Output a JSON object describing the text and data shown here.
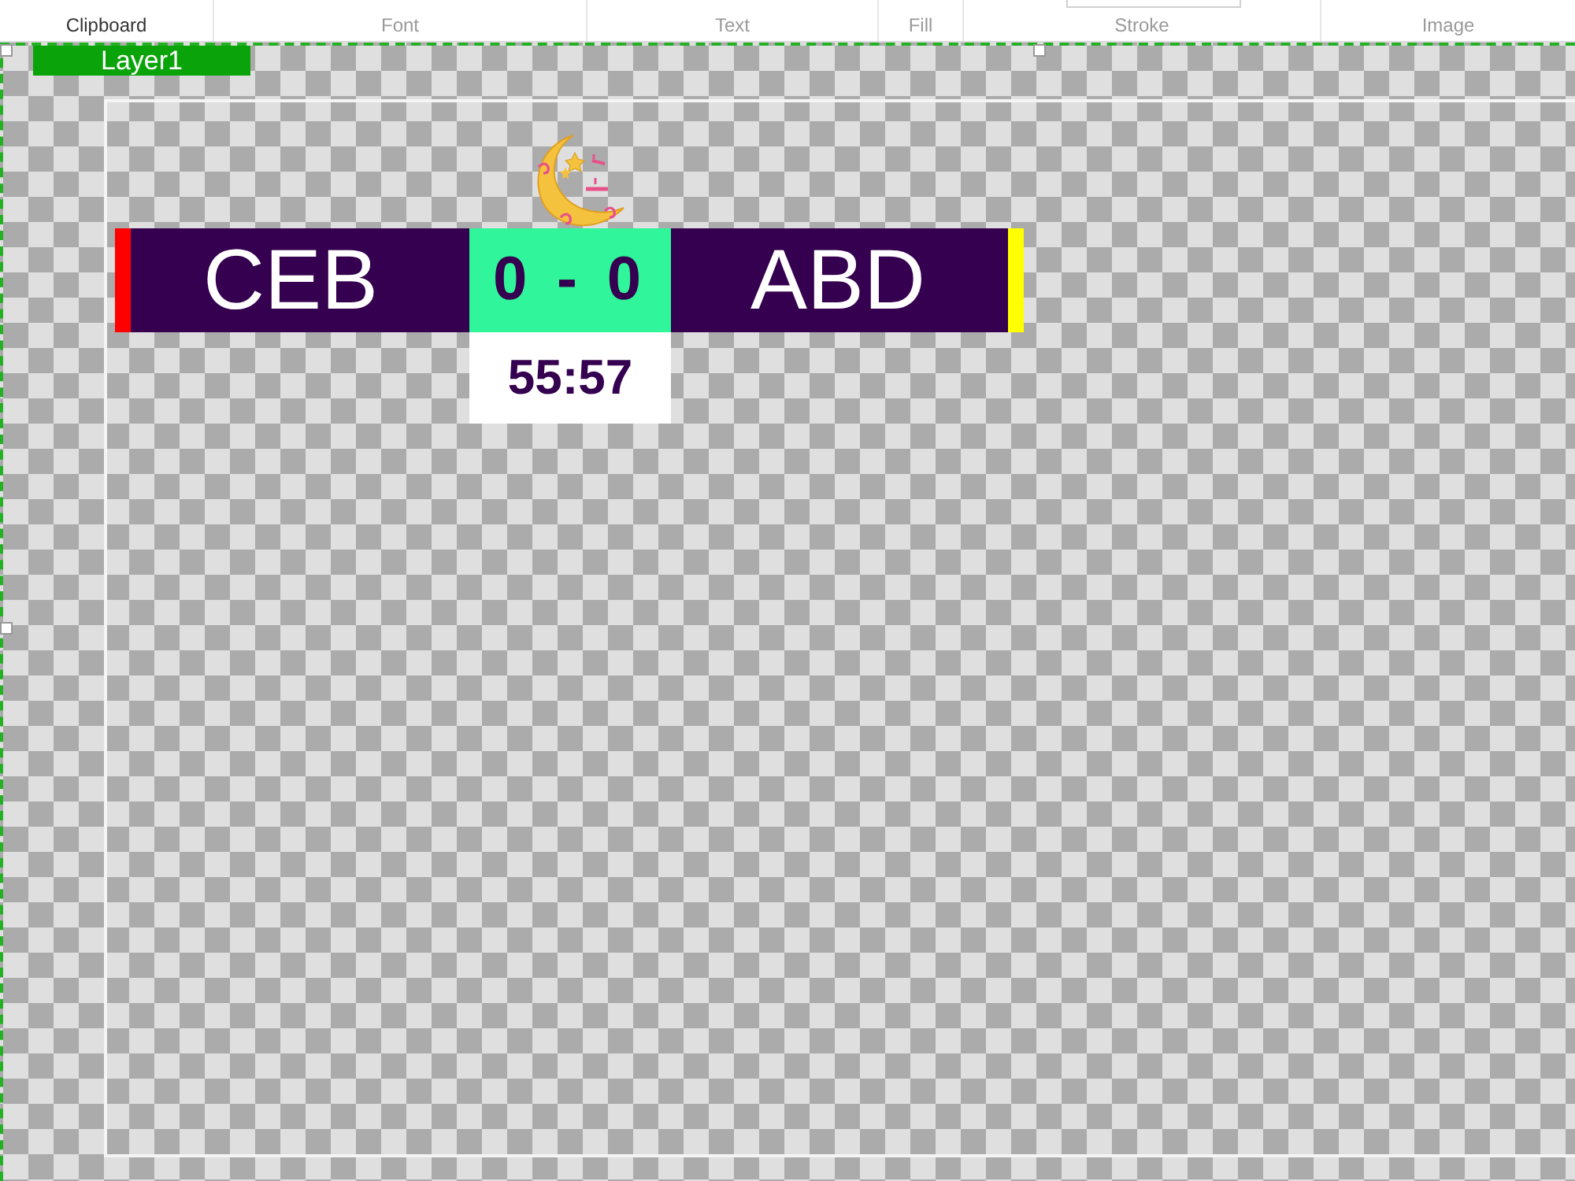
{
  "ribbon": {
    "groups": [
      {
        "label": "Clipboard",
        "disabled": false
      },
      {
        "label": "Font",
        "disabled": true
      },
      {
        "label": "Text",
        "disabled": true
      },
      {
        "label": "Fill",
        "disabled": true
      },
      {
        "label": "Stroke",
        "disabled": true
      },
      {
        "label": "Image",
        "disabled": true
      }
    ]
  },
  "canvas": {
    "layer": {
      "label": "Layer1"
    },
    "scoreboard": {
      "home": {
        "name": "CEB",
        "color": "#ff0000"
      },
      "score": "0 - 0",
      "away": {
        "name": "ABD",
        "color": "#ffff00"
      },
      "clock": "55:57"
    }
  }
}
